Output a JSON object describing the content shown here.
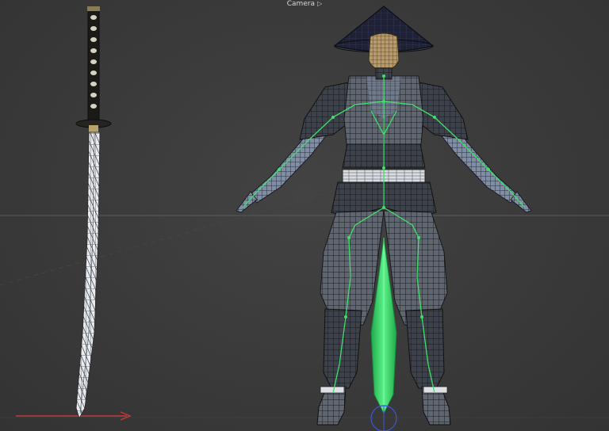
{
  "viewport": {
    "camera_label": "Camera",
    "camera_icon": "camera-icon",
    "background_color": "#3b3b3b",
    "grid_line_color": "#5a5a5a",
    "x_axis_color": "#c23b3b",
    "skeleton_color": "#3fe06a",
    "selected_bone_color": "#32d36a",
    "wireframe_color": "#1c1c1c",
    "objects": [
      "katana-model",
      "samurai-character-model",
      "skeleton-rig"
    ]
  }
}
